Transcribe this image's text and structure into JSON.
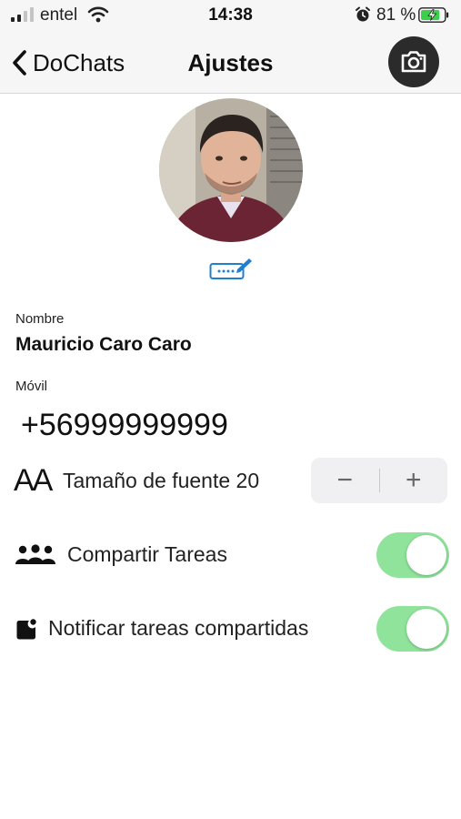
{
  "status_bar": {
    "carrier": "entel",
    "time": "14:38",
    "battery_percent": "81 %",
    "battery_level": 0.81
  },
  "nav": {
    "back_label": "DoChats",
    "title": "Ajustes"
  },
  "profile": {
    "name_label": "Nombre",
    "name_value": "Mauricio Caro Caro",
    "phone_label": "Móvil",
    "phone_value": "+56999999999"
  },
  "settings": {
    "font_size_label": "Tamaño de fuente 20",
    "font_size_icon_text": "AA",
    "stepper_minus": "−",
    "stepper_plus": "+",
    "share_tasks_label": "Compartir Tareas",
    "share_tasks_on": true,
    "notify_shared_label": "Notificar tareas compartidas",
    "notify_shared_on": true
  },
  "colors": {
    "toggle_on": "#8fe39b",
    "accent_blue": "#1f7fd0",
    "battery_green": "#3ccf4e"
  }
}
